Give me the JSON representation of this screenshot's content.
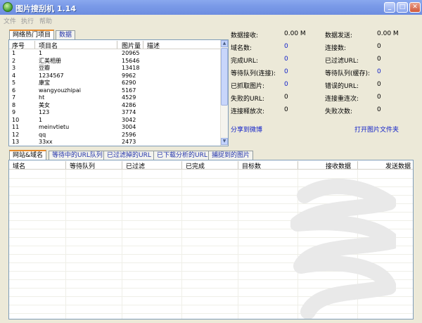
{
  "window": {
    "title": "图片搜刮机 1.14"
  },
  "menu": [
    "文件",
    "执行",
    "帮助"
  ],
  "top_tabs": [
    {
      "label": "网络热门项目"
    },
    {
      "label": "数据"
    }
  ],
  "hot_table": {
    "columns": [
      "序号",
      "项目名",
      "图片量",
      "描述"
    ],
    "rows": [
      [
        "1",
        "1",
        "20965"
      ],
      [
        "2",
        "汇美相册",
        "15646"
      ],
      [
        "3",
        "豆瓣",
        "13418"
      ],
      [
        "4",
        "1234567",
        "9962"
      ],
      [
        "5",
        "康宝",
        "6290"
      ],
      [
        "6",
        "wangyouzhipai",
        "5167"
      ],
      [
        "7",
        "ht",
        "4529"
      ],
      [
        "8",
        "美女",
        "4286"
      ],
      [
        "9",
        "123",
        "3774"
      ],
      [
        "10",
        "1",
        "3042"
      ],
      [
        "11",
        "meinvtietu",
        "3004"
      ],
      [
        "12",
        "qq",
        "2596"
      ],
      [
        "13",
        "33xx",
        "2473"
      ]
    ]
  },
  "stats_left": [
    {
      "label": "数据接收:",
      "value": "0.00 M"
    },
    {
      "label": "域名数:",
      "value": "0"
    },
    {
      "label": "完成URL:",
      "value": "0"
    },
    {
      "label": "等待队列(连接):",
      "value": "0"
    },
    {
      "label": "已抓取图片:",
      "value": "0"
    },
    {
      "label": "失败的URL:",
      "value": "0"
    },
    {
      "label": "连接释放次:",
      "value": "0"
    }
  ],
  "stats_right": [
    {
      "label": "数据发送:",
      "value": "0.00 M"
    },
    {
      "label": "连接数:",
      "value": "0"
    },
    {
      "label": "已过滤URL:",
      "value": "0"
    },
    {
      "label": "等待队列(缓存):",
      "value": "0"
    },
    {
      "label": "错误的URL:",
      "value": "0"
    },
    {
      "label": "连接重连次:",
      "value": "0"
    },
    {
      "label": "失败次数:",
      "value": "0"
    }
  ],
  "links": {
    "share": "分享到微博",
    "open_folder": "打开图片文件夹"
  },
  "bottom_tabs": [
    {
      "label": "网站&域名"
    },
    {
      "label": "等待中的URL队列"
    },
    {
      "label": "已过滤掉的URL"
    },
    {
      "label": "已下载分析的URL"
    },
    {
      "label": "捕捉到的图片"
    }
  ],
  "bottom_table": {
    "columns": [
      "域名",
      "等待队列",
      "已过滤",
      "已完成",
      "目标数",
      "接收数据",
      "发送数据"
    ]
  },
  "colors": {
    "title_bar": "#7a9ae8",
    "link": "#1020c8",
    "tab_accent": "#e68b2c"
  }
}
